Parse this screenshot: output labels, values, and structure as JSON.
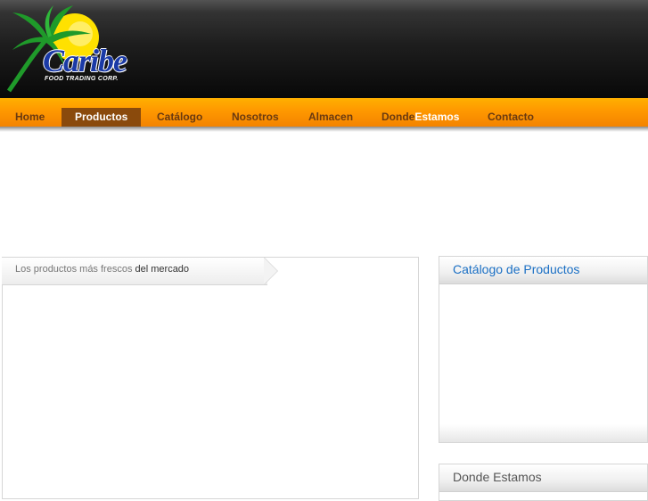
{
  "brand": {
    "name": "Caribe",
    "tagline": "FOOD TRADING CORP."
  },
  "nav": {
    "items": [
      {
        "label": "Home"
      },
      {
        "label": "Productos"
      },
      {
        "label": "Catálogo"
      },
      {
        "label": "Nosotros"
      },
      {
        "label": "Almacen"
      },
      {
        "label_a": "Donde",
        "label_b": "Estamos"
      },
      {
        "label": "Contacto"
      }
    ],
    "active": "Productos"
  },
  "main": {
    "tab": {
      "text_a": "Los productos más frescos",
      "text_b": " del mercado"
    }
  },
  "sidebar": {
    "catalog_title": "Catálogo de Productos",
    "location_title": "Donde Estamos"
  },
  "colors": {
    "nav_orange": "#ff9a00",
    "nav_active": "#8a4a0c",
    "link_blue": "#1a6fc4",
    "logo_blue": "#1b3aa6",
    "logo_green": "#1f9a2a",
    "logo_yellow": "#ffe100"
  },
  "icons": [
    "palm-tree-logo-icon",
    "sun-logo-icon"
  ]
}
